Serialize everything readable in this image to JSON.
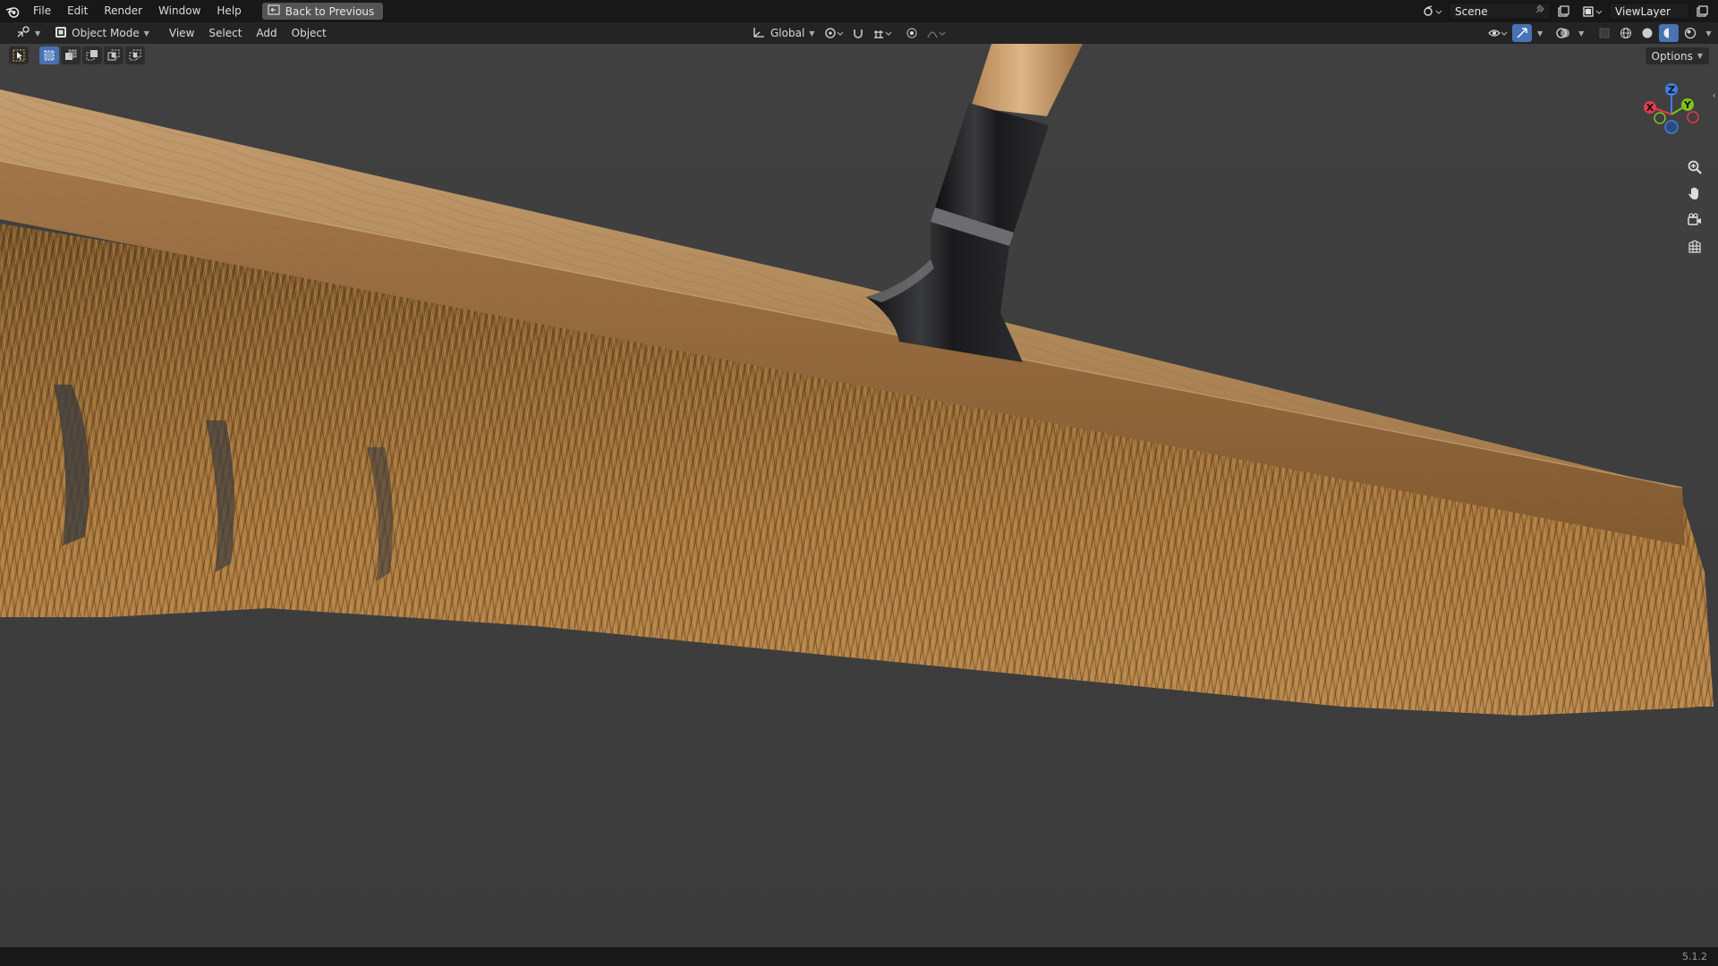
{
  "menu": {
    "items": [
      "File",
      "Edit",
      "Render",
      "Window",
      "Help"
    ],
    "back_button": "Back to Previous"
  },
  "scene": {
    "name": "Scene"
  },
  "view_layer": {
    "name": "ViewLayer"
  },
  "header": {
    "mode": "Object Mode",
    "items": [
      "View",
      "Select",
      "Add",
      "Object"
    ],
    "orientation": "Global"
  },
  "viewport": {
    "options_label": "Options",
    "gizmo": {
      "z": "Z",
      "y": "Y",
      "x": "X"
    }
  },
  "status": {
    "version": "5.1.2"
  },
  "colors": {
    "accent": "#4772b3",
    "x_axis": "#e23b4b",
    "y_axis": "#7cc61a",
    "z_axis": "#3f7de0"
  },
  "icons": [
    "blender-logo-icon",
    "back-icon",
    "editor-type-icon",
    "object-mode-icon",
    "orientation-icon",
    "pivot-icon",
    "snap-icon",
    "snap-target-icon",
    "proportional-icon",
    "falloff-icon",
    "visibility-icon",
    "gizmo-icon",
    "overlay-icon",
    "xray-icon",
    "wireframe-shading-icon",
    "solid-shading-icon",
    "material-shading-icon",
    "rendered-shading-icon",
    "select-tool-icon",
    "zoom-icon",
    "pan-hand-icon",
    "camera-icon",
    "ortho-grid-icon",
    "scene-icon",
    "pin-icon",
    "new-scene-icon",
    "view-layer-icon",
    "new-layer-icon"
  ]
}
